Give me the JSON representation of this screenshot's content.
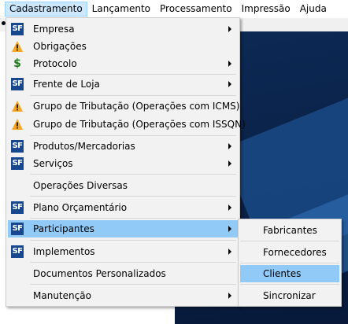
{
  "menubar": {
    "items": [
      {
        "label": "Cadastramento"
      },
      {
        "label": "Lançamento"
      },
      {
        "label": "Processamento"
      },
      {
        "label": "Impressão"
      },
      {
        "label": "Ajuda"
      }
    ]
  },
  "menu": {
    "items": [
      {
        "label": "Empresa",
        "icon": "sf-logo-icon",
        "submenu": true
      },
      {
        "label": "Obrigações",
        "icon": "warning-icon",
        "submenu": false
      },
      {
        "label": "Protocolo",
        "icon": "dollar-icon",
        "submenu": true
      },
      {
        "label": "Frente de Loja",
        "icon": "sf-logo-icon",
        "submenu": true
      },
      {
        "label": "Grupo de Tributação (Operações com ICMS)",
        "icon": "warning-icon",
        "submenu": false
      },
      {
        "label": "Grupo de Tributação (Operações com ISSQN)",
        "icon": "warning-icon",
        "submenu": false
      },
      {
        "label": "Produtos/Mercadorias",
        "icon": "sf-logo-icon",
        "submenu": true
      },
      {
        "label": "Serviços",
        "icon": "sf-logo-icon",
        "submenu": true
      },
      {
        "label": "Operações Diversas",
        "icon": "",
        "submenu": false
      },
      {
        "label": "Plano Orçamentário",
        "icon": "sf-logo-icon",
        "submenu": true
      },
      {
        "label": "Participantes",
        "icon": "sf-logo-icon",
        "submenu": true,
        "highlighted": true
      },
      {
        "label": "Implementos",
        "icon": "sf-logo-icon",
        "submenu": true
      },
      {
        "label": "Documentos Personalizados",
        "icon": "",
        "submenu": false
      },
      {
        "label": "Manutenção",
        "icon": "",
        "submenu": true
      }
    ],
    "sf_logo_text": "SF",
    "dollar_glyph": "$"
  },
  "submenu": {
    "items": [
      {
        "label": "Fabricantes"
      },
      {
        "label": "Fornecedores"
      },
      {
        "label": "Clientes",
        "highlighted": true
      },
      {
        "label": "Sincronizar"
      }
    ]
  },
  "colors": {
    "highlight": "#91c9f7",
    "menubar_active": "#cce8ff",
    "sf_logo": "#17488f",
    "warning": "#f5a623",
    "dollar": "#1e7a1e",
    "background_dark": "#0a2249"
  }
}
